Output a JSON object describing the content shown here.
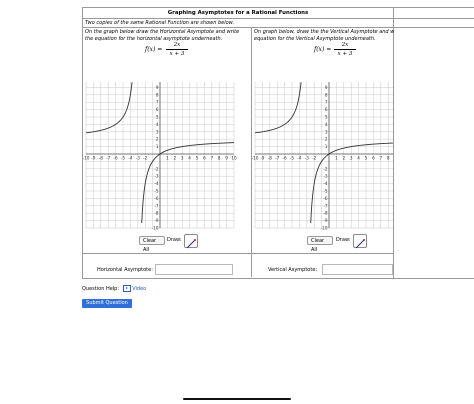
{
  "title": "Graphing Asymptotes for a Rational Functions",
  "intro": "Two copies of the same Rational Function are shown below.",
  "left": {
    "instr1": "On the graph below draw the Horizontal Asymptote and write",
    "instr2": "the equation for the horizontal asymptote underneath.",
    "fx": "f(x) =",
    "numerator": "2x",
    "denominator": "x + 3",
    "clear_label": "Clear All",
    "draw_label": "Draw:",
    "answer_label": "Horizontal Asymptote:",
    "answer_value": ""
  },
  "right": {
    "instr1": "On graph below, draw the the Vertical Asymptote and w",
    "instr2": "equation for the Vertical Asymptote underneath.",
    "fx": "f(x) =",
    "numerator": "2x",
    "denominator": "x + 3",
    "clear_label": "Clear All",
    "draw_label": "Draw:",
    "answer_label": "Vertical Asymptote:",
    "answer_value": ""
  },
  "graph": {
    "x_ticks": [
      "-10",
      "-9",
      "-8",
      "-7",
      "-6",
      "-5",
      "-4",
      "-3",
      "-2",
      "1",
      "2",
      "3",
      "4",
      "5",
      "6",
      "7",
      "8",
      "9",
      "10"
    ],
    "y_ticks": [
      "10",
      "9",
      "8",
      "7",
      "6",
      "5",
      "4",
      "3",
      "2",
      "1",
      "-2",
      "-3",
      "-4",
      "-5",
      "-6",
      "-7",
      "-8",
      "-9",
      "-10"
    ],
    "xlim": [
      -10,
      10
    ],
    "ylim": [
      -10,
      10
    ],
    "curve_color": "#333333",
    "grid_color": "#c8c8c8"
  },
  "help": {
    "label": "Question Help:",
    "video": "Video"
  },
  "submit_label": "Submit Question",
  "colors": {
    "accent": "#2f6fd8",
    "link": "#2d5fb8"
  }
}
